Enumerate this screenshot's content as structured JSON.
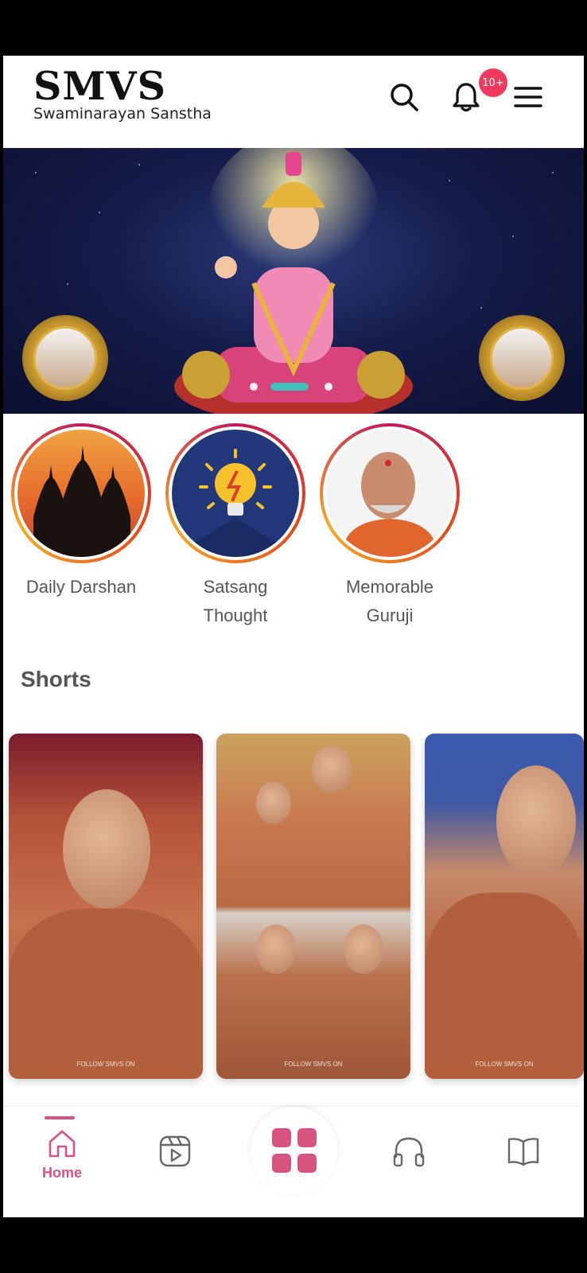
{
  "header": {
    "logo_title": "SMVS",
    "logo_subtitle": "Swaminarayan Sanstha",
    "notification_badge": "10+",
    "search_icon": "search-icon",
    "bell_icon": "bell-icon",
    "menu_icon": "hamburger-menu-icon"
  },
  "banner": {
    "slides_total": 3,
    "active_slide": 1
  },
  "categories": [
    {
      "label_1": "Daily Darshan",
      "label_2": ""
    },
    {
      "label_1": "Satsang",
      "label_2": "Thought"
    },
    {
      "label_1": "Memorable",
      "label_2": "Guruji"
    }
  ],
  "shorts": {
    "title": "Shorts",
    "watermark": "FOLLOW SMVS ON"
  },
  "bottom_nav": {
    "home_label": "Home",
    "accent_color": "#d6547f"
  }
}
